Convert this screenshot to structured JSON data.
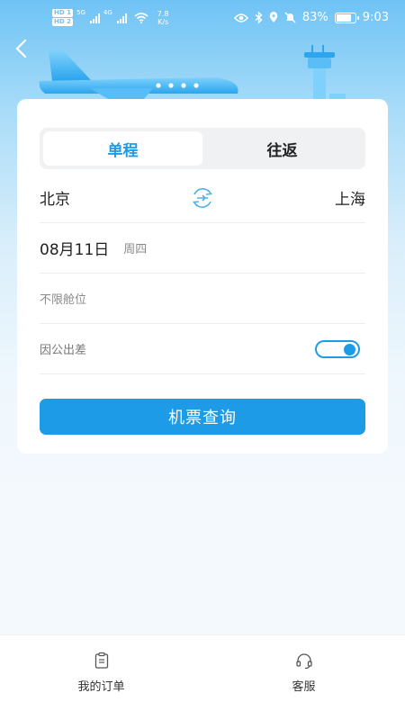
{
  "status_bar": {
    "hd1": "HD 1",
    "hd2": "HD 2",
    "sig1_label": "5G",
    "sig2_label": "4G",
    "net_speed": "7.8",
    "net_unit": "K/s",
    "battery": "83%",
    "time": "9:03"
  },
  "nav": {
    "back_icon": "chevron-left-icon"
  },
  "trip_tabs": {
    "one_way": "单程",
    "round_trip": "往返"
  },
  "search": {
    "from_city": "北京",
    "to_city": "上海",
    "date": "08月11日",
    "weekday": "周四",
    "cabin": "不限舱位",
    "business_trip_label": "因公出差",
    "business_trip_enabled": true,
    "submit_label": "机票查询"
  },
  "bottom_nav": {
    "orders_label": "我的订单",
    "service_label": "客服"
  },
  "colors": {
    "accent": "#1e9be6",
    "hero_top": "#6fc3f5"
  }
}
